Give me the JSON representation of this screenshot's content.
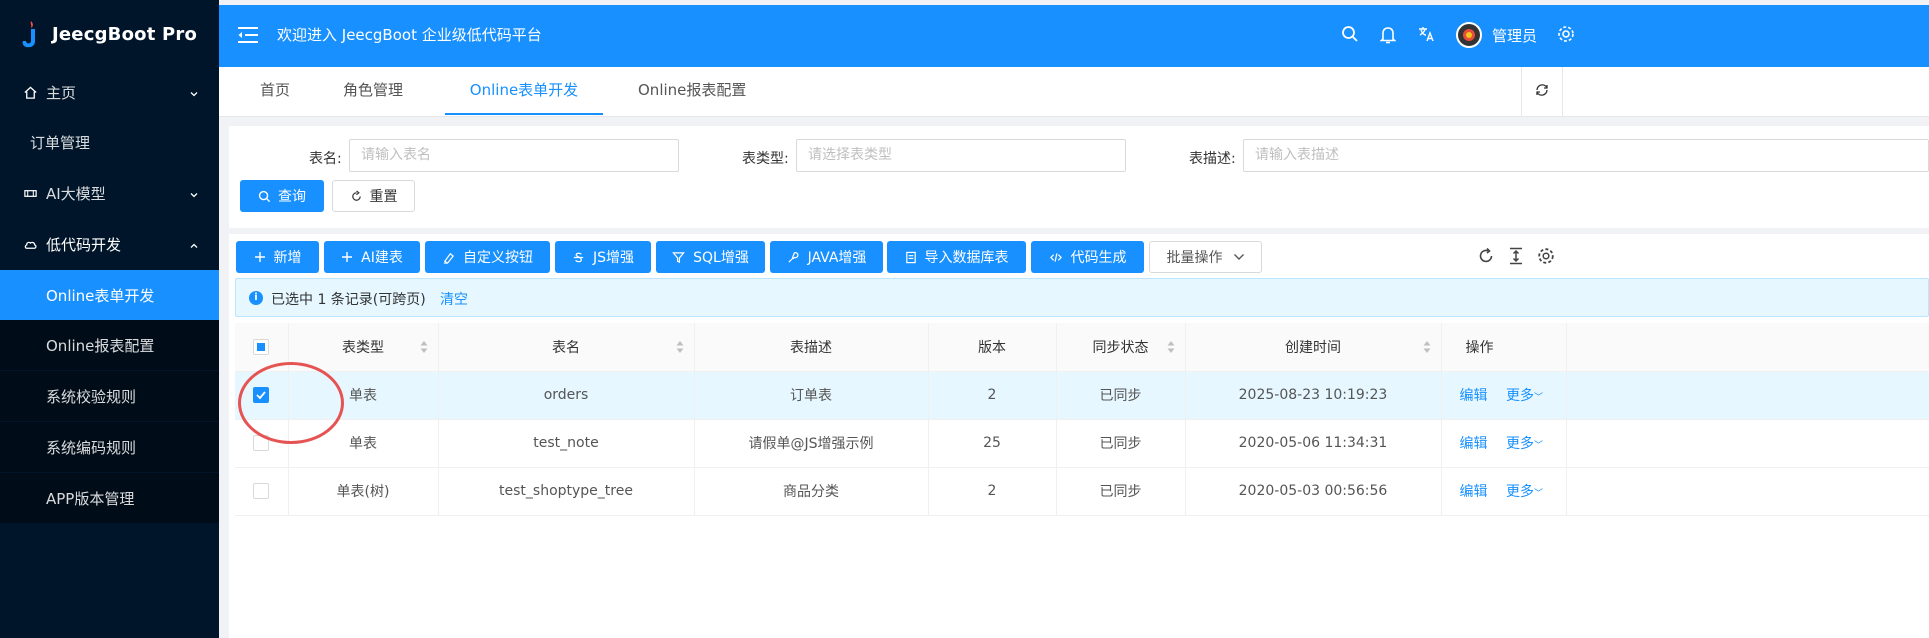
{
  "app": {
    "logo_text": "JeecgBoot Pro"
  },
  "sidebar": {
    "items": [
      {
        "label": "主页",
        "icon": "home-icon"
      },
      {
        "label": "订单管理"
      },
      {
        "label": "AI大模型",
        "icon": "ai-model-icon"
      },
      {
        "label": "低代码开发",
        "icon": "cloud-icon"
      },
      {
        "label": "Online表单开发"
      },
      {
        "label": "Online报表配置"
      },
      {
        "label": "系统校验规则"
      },
      {
        "label": "系统编码规则"
      },
      {
        "label": "APP版本管理"
      }
    ]
  },
  "header": {
    "welcome": "欢迎进入 JeecgBoot 企业级低代码平台",
    "user_name": "管理员"
  },
  "tabs": [
    {
      "label": "首页"
    },
    {
      "label": "角色管理"
    },
    {
      "label": "Online表单开发"
    },
    {
      "label": "Online报表配置"
    }
  ],
  "search": {
    "table_name_label": "表名:",
    "table_name_placeholder": "请输入表名",
    "table_type_label": "表类型:",
    "table_type_placeholder": "请选择表类型",
    "table_desc_label": "表描述:",
    "table_desc_placeholder": "请输入表描述",
    "query_label": "查询",
    "reset_label": "重置"
  },
  "toolbar": {
    "add": "新增",
    "ai_build": "AI建表",
    "custom_button": "自定义按钮",
    "js_enhance": "JS增强",
    "sql_enhance": "SQL增强",
    "java_enhance": "JAVA增强",
    "import_db": "导入数据库表",
    "code_gen": "代码生成",
    "batch": "批量操作"
  },
  "alert": {
    "message": "已选中 1 条记录(可跨页)",
    "clear": "清空"
  },
  "table": {
    "columns": [
      "表类型",
      "表名",
      "表描述",
      "版本",
      "同步状态",
      "创建时间",
      "操作"
    ],
    "rows": [
      {
        "type": "单表",
        "name": "orders",
        "desc": "订单表",
        "version": "2",
        "status": "已同步",
        "created": "2025-08-23 10:19:23",
        "edit": "编辑",
        "more": "更多"
      },
      {
        "type": "单表",
        "name": "test_note",
        "desc": "请假单@JS增强示例",
        "version": "25",
        "status": "已同步",
        "created": "2020-05-06 11:34:31",
        "edit": "编辑",
        "more": "更多"
      },
      {
        "type": "单表(树)",
        "name": "test_shoptype_tree",
        "desc": "商品分类",
        "version": "2",
        "status": "已同步",
        "created": "2020-05-03 00:56:56",
        "edit": "编辑",
        "more": "更多"
      }
    ]
  },
  "colors": {
    "primary": "#1890ff",
    "sidebar": "#001529",
    "success": "#52c41a",
    "annotation": "#e55353"
  }
}
